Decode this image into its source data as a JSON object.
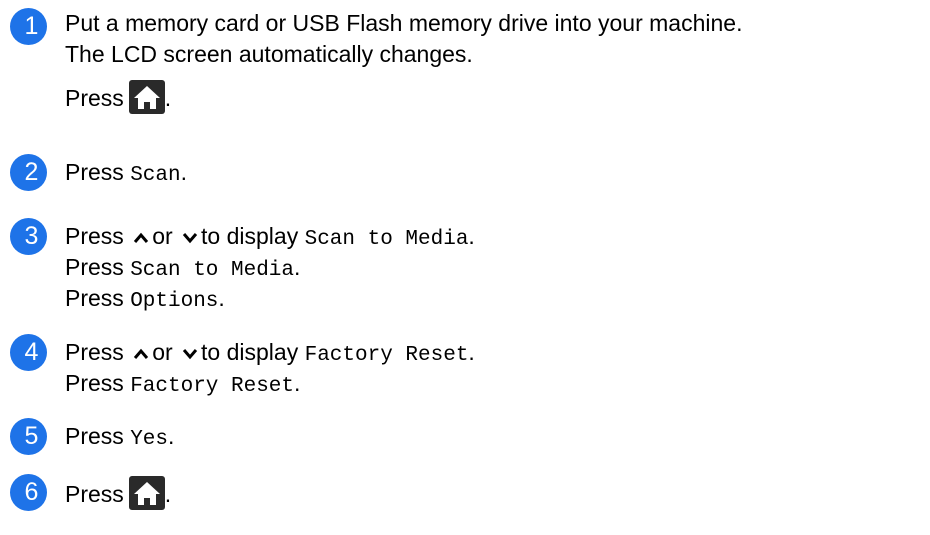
{
  "colors": {
    "badge": "#1e73e8",
    "icon": "#2a2a2a"
  },
  "steps": [
    {
      "number": "1",
      "line1": "Put a memory card or USB Flash memory drive into your machine.",
      "line2": "The LCD screen automatically changes.",
      "line3_press": "Press",
      "line3_icon": "home-icon",
      "line3_end": "."
    },
    {
      "number": "2",
      "press": "Press",
      "option": "Scan",
      "end": "."
    },
    {
      "number": "3",
      "l1_press": "Press",
      "l1_or": "or",
      "l1_display": "to display",
      "l1_option": "Scan to Media",
      "l1_end": ".",
      "l2_press": "Press",
      "l2_option": "Scan to Media",
      "l2_end": ".",
      "l3_press": "Press",
      "l3_option": "Options",
      "l3_end": "."
    },
    {
      "number": "4",
      "l1_press": "Press",
      "l1_or": "or",
      "l1_display": "to display",
      "l1_option": "Factory Reset",
      "l1_end": ".",
      "l2_press": "Press",
      "l2_option": "Factory Reset",
      "l2_end": "."
    },
    {
      "number": "5",
      "press": "Press",
      "option": "Yes",
      "end": "."
    },
    {
      "number": "6",
      "press": "Press",
      "icon": "home-icon",
      "end": "."
    }
  ]
}
